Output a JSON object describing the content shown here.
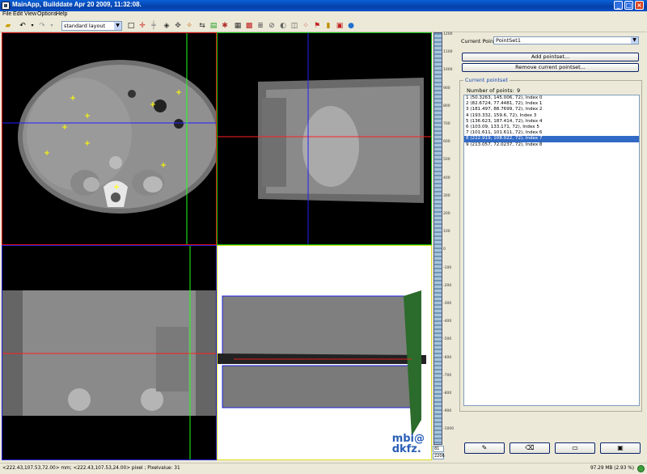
{
  "window": {
    "title": "MainApp, Builddate Apr 20 2009, 11:32:08.",
    "buttons": {
      "minimize": "_",
      "maximize": "□",
      "close": "×"
    }
  },
  "menu": [
    "File",
    "Edit",
    "View",
    "Options",
    "Help"
  ],
  "toolbar": {
    "layout_select": "standard layout"
  },
  "slider": {
    "ticks": [
      "1200",
      "1100",
      "1000",
      "900",
      "800",
      "700",
      "600",
      "500",
      "400",
      "300",
      "200",
      "100",
      "0",
      "-100",
      "-200",
      "-300",
      "-400",
      "-500",
      "-600",
      "-700",
      "-800",
      "-900",
      "-1000"
    ],
    "level": "81",
    "window": "2206"
  },
  "panel": {
    "current_pointset_label": "Current PointSet",
    "current_pointset_value": "PointSet1",
    "add_button": "Add pointset...",
    "remove_button": "Remove current pointset...",
    "group_title": "Current pointset",
    "num_points_label": "Number of points:",
    "num_points_value": "9",
    "points": [
      "1  (50.3263,  145.006,  72), Index 0",
      "2  (82.6724,  77.4481,  72), Index 1",
      "3  (181.497,  88.7699,  72), Index 2",
      "4  (193.332,  159.6,  72), Index 3",
      "5  (136.623,  187.414,  72), Index 4",
      "6  (103.09,  133.171,  72), Index 5",
      "7  (101.611,  101.611,  72), Index 6",
      "8  (222.919,  108.022,  72), Index 7",
      "9  (213.057,  72.0237,  72), Index 8"
    ],
    "selected_index": 7
  },
  "logo": {
    "line1": "mbi@",
    "line2": "dkfz."
  },
  "status": {
    "left": "<222.43,107.53,72.00> mm; <222.43,107.53,24.00> pixel ; Pixelvalue: 31",
    "right": "97.29 MB (2.93 %)"
  }
}
